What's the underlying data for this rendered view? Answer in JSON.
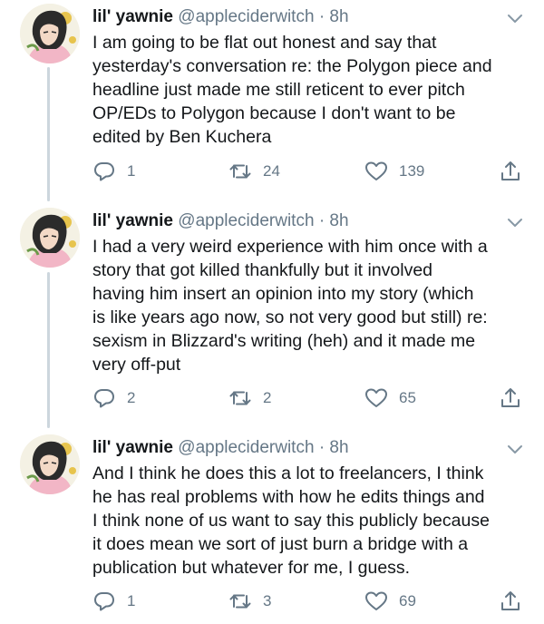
{
  "tweets": [
    {
      "name": "lil' yawnie",
      "handle": "@appleciderwitch",
      "separator": "·",
      "time": "8h",
      "text": "I am going to be flat out honest and say that\nyesterday's conversation re: the Polygon piece and\nheadline just made me still reticent to ever pitch\nOP/EDs to Polygon because I don't want to be\nedited by Ben Kuchera",
      "replies": "1",
      "retweets": "24",
      "likes": "139"
    },
    {
      "name": "lil' yawnie",
      "handle": "@appleciderwitch",
      "separator": "·",
      "time": "8h",
      "text": "I had a very weird experience with him once with a\nstory that got killed thankfully but it involved\nhaving him insert an opinion into my story (which\nis like years ago now, so not very good but still) re:\nsexism in Blizzard's writing (heh) and it made me\nvery off-put",
      "replies": "2",
      "retweets": "2",
      "likes": "65"
    },
    {
      "name": "lil' yawnie",
      "handle": "@appleciderwitch",
      "separator": "·",
      "time": "8h",
      "text": "And I think he does this a lot to freelancers, I think\nhe has real problems with how he edits things and\nI think none of us want to say this publicly because\nit does mean we sort of just burn a bridge with a\npublication but whatever for me, I guess.",
      "replies": "1",
      "retweets": "3",
      "likes": "69"
    }
  ],
  "icons": {
    "chevron": "chevron-down-icon",
    "reply": "reply-icon",
    "retweet": "retweet-icon",
    "like": "heart-icon",
    "share": "share-icon"
  },
  "colors": {
    "text": "#14171a",
    "secondary": "#657786",
    "thread_line": "#ccd6dd"
  }
}
